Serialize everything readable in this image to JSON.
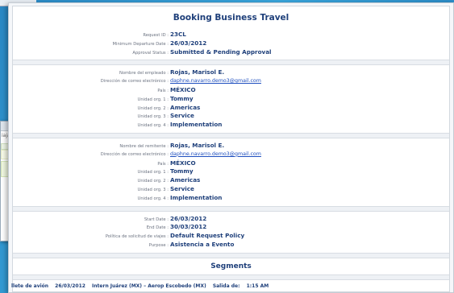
{
  "header": {
    "title": "Booking Business Travel"
  },
  "request": [
    {
      "label": "Request ID :",
      "value": "23CL"
    },
    {
      "label": "Minimum Departure Date :",
      "value": "26/03/2012"
    },
    {
      "label": "Approval Status :",
      "value": "Submitted & Pending Approval"
    }
  ],
  "employee": [
    {
      "label": "Nombre del empleado :",
      "value": "Rojas, Marisol E."
    },
    {
      "label": "Dirección de correo electrónico :",
      "value": "daphne.navarro.demo3@gmail.com",
      "link": true
    },
    {
      "label": "País :",
      "value": "MÉXICO"
    },
    {
      "label": "Unidad org. 1 :",
      "value": "Tommy"
    },
    {
      "label": "Unidad org. 2 :",
      "value": "Americas"
    },
    {
      "label": "Unidad org. 3 :",
      "value": "Service"
    },
    {
      "label": "Unidad org. 4 :",
      "value": "Implementation"
    }
  ],
  "sender": [
    {
      "label": "Nombre del remitente :",
      "value": "Rojas, Marisol E."
    },
    {
      "label": "Dirección de correo electrónico :",
      "value": "daphne.navarro.demo3@gmail.com",
      "link": true
    },
    {
      "label": "País :",
      "value": "MÉXICO"
    },
    {
      "label": "Unidad org. 1 :",
      "value": "Tommy"
    },
    {
      "label": "Unidad org. 2 :",
      "value": "Americas"
    },
    {
      "label": "Unidad org. 3 :",
      "value": "Service"
    },
    {
      "label": "Unidad org. 4 :",
      "value": "Implementation"
    }
  ],
  "trip": [
    {
      "label": "Start Date :",
      "value": "26/03/2012"
    },
    {
      "label": "End Date :",
      "value": "30/03/2012"
    },
    {
      "label": "Política de solicitud de viajes :",
      "value": "Default Request Policy"
    },
    {
      "label": "Purpose :",
      "value": "Asistencia a Evento"
    }
  ],
  "segments": {
    "title": "Segments",
    "line": {
      "type": "llete de avión",
      "date": "26/03/2012",
      "route": "Intern Juárez (MX) – Aerop Escobedo (MX)",
      "departure_label": "Salida de:",
      "departure_time": "1:15 AM"
    }
  },
  "background_window": {
    "text": "iaja"
  },
  "colors": {
    "accent": "#1e3f7a",
    "link": "#1f4fbf",
    "desktop": "#2f8fc9"
  }
}
